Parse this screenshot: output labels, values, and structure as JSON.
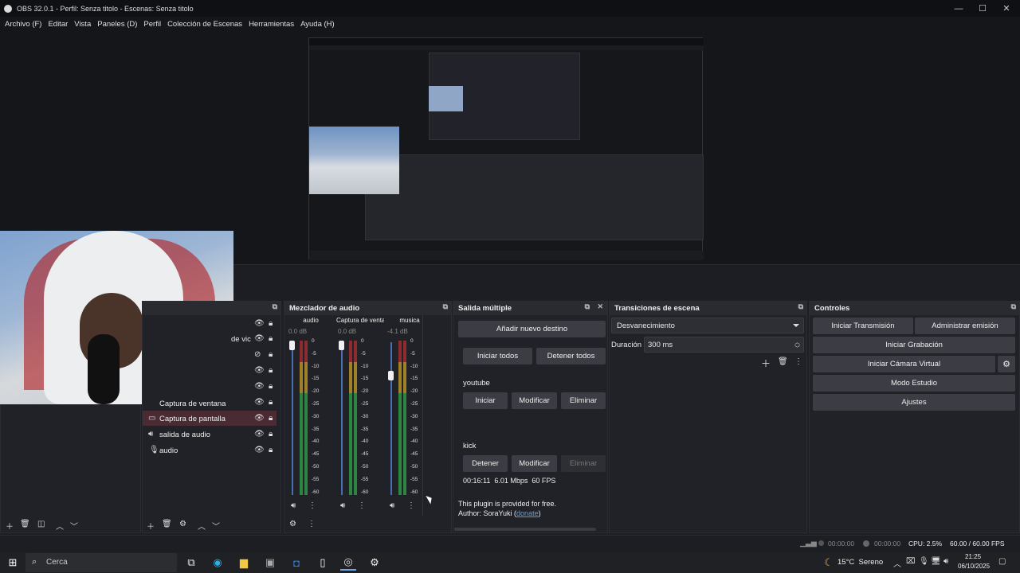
{
  "window": {
    "title": "OBS 32.0.1 - Perfil: Senza titolo - Escenas: Senza titolo",
    "min": "—",
    "max": "☐",
    "close": "✕"
  },
  "menu": [
    "Archivo (F)",
    "Editar",
    "Vista",
    "Paneles (D)",
    "Perfil",
    "Colección de Escenas",
    "Herramientas",
    "Ayuda (H)"
  ],
  "sources": {
    "items": [
      {
        "label": "de vic",
        "icon": ""
      },
      {
        "label": "Captura de ventana",
        "icon": "window-icon"
      },
      {
        "label": "Captura de pantalla",
        "icon": "monitor-icon"
      },
      {
        "label": "salida de audio",
        "icon": "speaker-icon"
      },
      {
        "label": "audio",
        "icon": "mic-icon"
      }
    ]
  },
  "mixer": {
    "title": "Mezclador de audio",
    "channels": [
      {
        "name": "audio",
        "db": "0.0 dB",
        "fader": 1.0
      },
      {
        "name": "Captura de ventana",
        "db": "0.0 dB",
        "fader": 1.0
      },
      {
        "name": "musica",
        "db": "-4.1 dB",
        "fader": 0.8
      }
    ],
    "scale": [
      "0",
      "-5",
      "-10",
      "-15",
      "-20",
      "-25",
      "-30",
      "-35",
      "-40",
      "-45",
      "-50",
      "-55",
      "-60"
    ]
  },
  "multi": {
    "title": "Salida múltiple",
    "add": "Añadir nuevo destino",
    "start_all": "Iniciar todos",
    "stop_all": "Detener todos",
    "t1_name": "youtube",
    "t1_start": "Iniciar",
    "t1_modify": "Modificar",
    "t1_delete": "Eliminar",
    "t2_name": "kick",
    "t2_stop": "Detener",
    "t2_modify": "Modificar",
    "t2_delete": "Eliminar",
    "stats": "00:16:11  6.01 Mbps  60 FPS",
    "plugin_note": "This plugin is provided for free.",
    "author": "Author: SoraYuki (",
    "donate": "donate",
    "author_end": ")"
  },
  "transitions": {
    "title": "Transiciones de escena",
    "selected": "Desvanecimiento",
    "duration_label": "Duración",
    "duration_value": "300 ms"
  },
  "controls": {
    "title": "Controles",
    "start_stream": "Iniciar Transmisión",
    "manage": "Administrar emisión",
    "start_rec": "Iniciar Grabación",
    "virtual_cam": "Iniciar Cámara Virtual",
    "studio": "Modo Estudio",
    "settings": "Ajustes"
  },
  "status": {
    "stream_time": "00:00:00",
    "rec_time": "00:00:00",
    "cpu": "CPU: 2.5%",
    "fps": "60.00 / 60.00 FPS"
  },
  "taskbar": {
    "search": "Cerca",
    "weather": "15°C  Sereno",
    "time": "21:25",
    "date": "06/10/2025"
  },
  "colors": {
    "accent": "#3c3d44",
    "meter_green": "#2fa84a",
    "meter_yellow": "#c9a227",
    "meter_red": "#b03030",
    "highlight_row": "#4a2a33"
  }
}
